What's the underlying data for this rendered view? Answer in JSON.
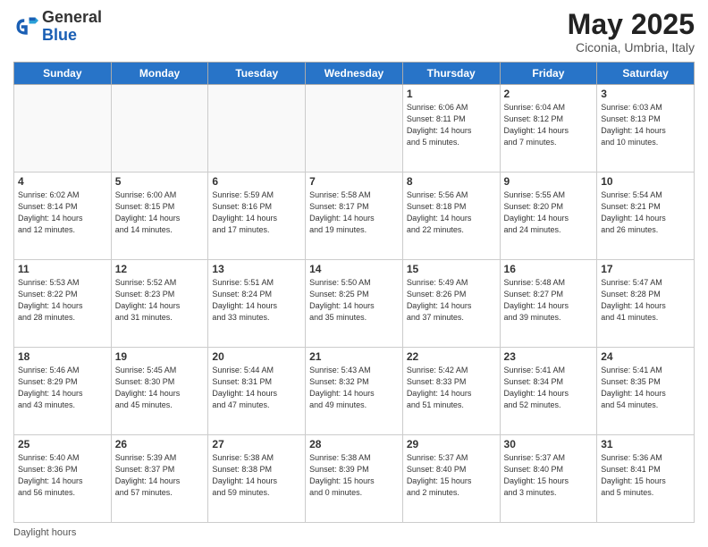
{
  "header": {
    "logo_general": "General",
    "logo_blue": "Blue",
    "month_title": "May 2025",
    "location": "Ciconia, Umbria, Italy"
  },
  "days_of_week": [
    "Sunday",
    "Monday",
    "Tuesday",
    "Wednesday",
    "Thursday",
    "Friday",
    "Saturday"
  ],
  "weeks": [
    [
      {
        "day": "",
        "content": ""
      },
      {
        "day": "",
        "content": ""
      },
      {
        "day": "",
        "content": ""
      },
      {
        "day": "",
        "content": ""
      },
      {
        "day": "1",
        "content": "Sunrise: 6:06 AM\nSunset: 8:11 PM\nDaylight: 14 hours\nand 5 minutes."
      },
      {
        "day": "2",
        "content": "Sunrise: 6:04 AM\nSunset: 8:12 PM\nDaylight: 14 hours\nand 7 minutes."
      },
      {
        "day": "3",
        "content": "Sunrise: 6:03 AM\nSunset: 8:13 PM\nDaylight: 14 hours\nand 10 minutes."
      }
    ],
    [
      {
        "day": "4",
        "content": "Sunrise: 6:02 AM\nSunset: 8:14 PM\nDaylight: 14 hours\nand 12 minutes."
      },
      {
        "day": "5",
        "content": "Sunrise: 6:00 AM\nSunset: 8:15 PM\nDaylight: 14 hours\nand 14 minutes."
      },
      {
        "day": "6",
        "content": "Sunrise: 5:59 AM\nSunset: 8:16 PM\nDaylight: 14 hours\nand 17 minutes."
      },
      {
        "day": "7",
        "content": "Sunrise: 5:58 AM\nSunset: 8:17 PM\nDaylight: 14 hours\nand 19 minutes."
      },
      {
        "day": "8",
        "content": "Sunrise: 5:56 AM\nSunset: 8:18 PM\nDaylight: 14 hours\nand 22 minutes."
      },
      {
        "day": "9",
        "content": "Sunrise: 5:55 AM\nSunset: 8:20 PM\nDaylight: 14 hours\nand 24 minutes."
      },
      {
        "day": "10",
        "content": "Sunrise: 5:54 AM\nSunset: 8:21 PM\nDaylight: 14 hours\nand 26 minutes."
      }
    ],
    [
      {
        "day": "11",
        "content": "Sunrise: 5:53 AM\nSunset: 8:22 PM\nDaylight: 14 hours\nand 28 minutes."
      },
      {
        "day": "12",
        "content": "Sunrise: 5:52 AM\nSunset: 8:23 PM\nDaylight: 14 hours\nand 31 minutes."
      },
      {
        "day": "13",
        "content": "Sunrise: 5:51 AM\nSunset: 8:24 PM\nDaylight: 14 hours\nand 33 minutes."
      },
      {
        "day": "14",
        "content": "Sunrise: 5:50 AM\nSunset: 8:25 PM\nDaylight: 14 hours\nand 35 minutes."
      },
      {
        "day": "15",
        "content": "Sunrise: 5:49 AM\nSunset: 8:26 PM\nDaylight: 14 hours\nand 37 minutes."
      },
      {
        "day": "16",
        "content": "Sunrise: 5:48 AM\nSunset: 8:27 PM\nDaylight: 14 hours\nand 39 minutes."
      },
      {
        "day": "17",
        "content": "Sunrise: 5:47 AM\nSunset: 8:28 PM\nDaylight: 14 hours\nand 41 minutes."
      }
    ],
    [
      {
        "day": "18",
        "content": "Sunrise: 5:46 AM\nSunset: 8:29 PM\nDaylight: 14 hours\nand 43 minutes."
      },
      {
        "day": "19",
        "content": "Sunrise: 5:45 AM\nSunset: 8:30 PM\nDaylight: 14 hours\nand 45 minutes."
      },
      {
        "day": "20",
        "content": "Sunrise: 5:44 AM\nSunset: 8:31 PM\nDaylight: 14 hours\nand 47 minutes."
      },
      {
        "day": "21",
        "content": "Sunrise: 5:43 AM\nSunset: 8:32 PM\nDaylight: 14 hours\nand 49 minutes."
      },
      {
        "day": "22",
        "content": "Sunrise: 5:42 AM\nSunset: 8:33 PM\nDaylight: 14 hours\nand 51 minutes."
      },
      {
        "day": "23",
        "content": "Sunrise: 5:41 AM\nSunset: 8:34 PM\nDaylight: 14 hours\nand 52 minutes."
      },
      {
        "day": "24",
        "content": "Sunrise: 5:41 AM\nSunset: 8:35 PM\nDaylight: 14 hours\nand 54 minutes."
      }
    ],
    [
      {
        "day": "25",
        "content": "Sunrise: 5:40 AM\nSunset: 8:36 PM\nDaylight: 14 hours\nand 56 minutes."
      },
      {
        "day": "26",
        "content": "Sunrise: 5:39 AM\nSunset: 8:37 PM\nDaylight: 14 hours\nand 57 minutes."
      },
      {
        "day": "27",
        "content": "Sunrise: 5:38 AM\nSunset: 8:38 PM\nDaylight: 14 hours\nand 59 minutes."
      },
      {
        "day": "28",
        "content": "Sunrise: 5:38 AM\nSunset: 8:39 PM\nDaylight: 15 hours\nand 0 minutes."
      },
      {
        "day": "29",
        "content": "Sunrise: 5:37 AM\nSunset: 8:40 PM\nDaylight: 15 hours\nand 2 minutes."
      },
      {
        "day": "30",
        "content": "Sunrise: 5:37 AM\nSunset: 8:40 PM\nDaylight: 15 hours\nand 3 minutes."
      },
      {
        "day": "31",
        "content": "Sunrise: 5:36 AM\nSunset: 8:41 PM\nDaylight: 15 hours\nand 5 minutes."
      }
    ]
  ],
  "footer": {
    "daylight_label": "Daylight hours"
  }
}
